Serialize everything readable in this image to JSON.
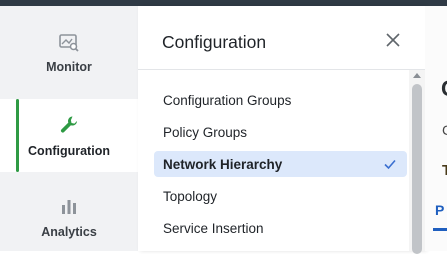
{
  "rail": {
    "items": [
      {
        "label": "Monitor",
        "icon": "monitor-icon"
      },
      {
        "label": "Configuration",
        "icon": "wrench-icon",
        "active": true
      },
      {
        "label": "Analytics",
        "icon": "bar-chart-icon"
      }
    ]
  },
  "panel": {
    "title": "Configuration",
    "items": [
      {
        "label": "Configuration Groups"
      },
      {
        "label": "Policy Groups"
      },
      {
        "label": "Network Hierarchy",
        "selected": true
      },
      {
        "label": "Topology"
      },
      {
        "label": "Service Insertion"
      }
    ]
  },
  "background": {
    "fragments": [
      "C",
      "C",
      "T",
      "P"
    ]
  },
  "colors": {
    "accent_green": "#2e9a44",
    "selected_bg": "#dce8fb",
    "link_blue": "#1f5fbf",
    "topbar": "#2f3a45"
  }
}
